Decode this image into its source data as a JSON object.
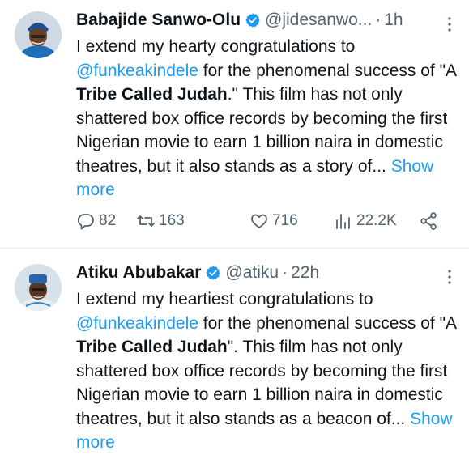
{
  "tweets": [
    {
      "name": "Babajide Sanwo-Olu",
      "handle": "@jidesanwo...",
      "dot": "·",
      "time": "1h",
      "text_parts": {
        "p1": "I extend my hearty congratulations to ",
        "mention": "@funkeakindele",
        "p2": " for the phenomenal success of \"A ",
        "bold": "Tribe Called Judah",
        "p3": ".\" This film has not only shattered box office records by becoming the first Nigerian movie to earn 1 billion naira in domestic theatres, but it also stands as a story of... ",
        "show_more": "Show more"
      },
      "stats": {
        "replies": "82",
        "reposts": "163",
        "likes": "716",
        "views": "22.2K"
      }
    },
    {
      "name": "Atiku Abubakar",
      "handle": "@atiku",
      "dot": "·",
      "time": "22h",
      "text_parts": {
        "p1": "I extend my heartiest congratulations to ",
        "mention": "@funkeakindele",
        "p2": " for the phenomenal success of \"A ",
        "bold": "Tribe Called Judah",
        "p3": "\". This film has not only shattered box office records by becoming the first Nigerian movie to earn 1 billion naira in domestic theatres, but it also stands as a beacon of... ",
        "show_more": "Show more"
      }
    }
  ],
  "icons": {
    "verified": "verified-badge-icon",
    "more": "more-options-icon",
    "reply": "reply-icon",
    "repost": "repost-icon",
    "like": "like-icon",
    "views": "views-icon",
    "share": "share-icon"
  },
  "colors": {
    "link": "#1d9bf0",
    "muted": "#536471",
    "text": "#0f1419",
    "divider": "#e6ecf0"
  }
}
